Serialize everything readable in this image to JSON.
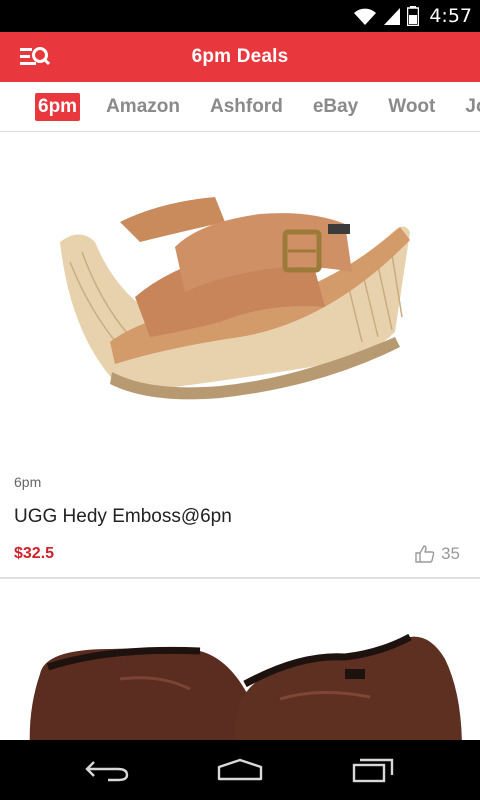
{
  "status_bar": {
    "time": "4:57",
    "icons": [
      "wifi-icon",
      "signal-icon",
      "battery-icon"
    ]
  },
  "app_bar": {
    "title": "6pm Deals",
    "menu_icon": "search-menu-icon"
  },
  "tabs": [
    {
      "label": "6pm",
      "active": true
    },
    {
      "label": "Amazon",
      "active": false
    },
    {
      "label": "Ashford",
      "active": false
    },
    {
      "label": "eBay",
      "active": false
    },
    {
      "label": "Woot",
      "active": false
    },
    {
      "label": "Jor",
      "active": false
    }
  ],
  "deals": [
    {
      "store": "6pm",
      "title": "UGG Hedy Emboss@6pn",
      "price": "$32.5",
      "likes": "35",
      "image": "tan-wedge-sandal"
    },
    {
      "image": "brown-leather-clog"
    }
  ],
  "nav_bar": {
    "icons": [
      "back-icon",
      "home-icon",
      "recent-apps-icon"
    ]
  },
  "colors": {
    "accent": "#e8383d",
    "price": "#d0202a",
    "tab_inactive": "#8a8a8a"
  }
}
